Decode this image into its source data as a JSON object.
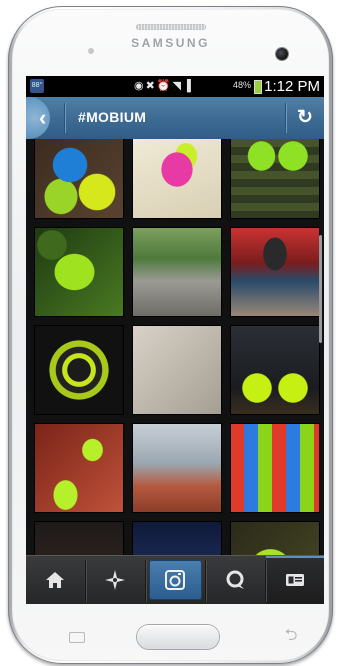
{
  "device": {
    "brand": "SAMSUNG"
  },
  "status_bar": {
    "battery_percent": "48%",
    "time": "1:12 PM",
    "icons": [
      "signal-icon",
      "mute-icon",
      "alarm-icon",
      "wifi-icon",
      "battery-icon"
    ]
  },
  "app_bar": {
    "title": "#MOBIUM",
    "back_icon": "chevron-left-icon",
    "refresh_icon": "refresh-icon"
  },
  "feed": {
    "photos": [
      {
        "desc": "blue and yellow running shoes pile"
      },
      {
        "desc": "pink and yellow running shoe"
      },
      {
        "desc": "green shoes on grass"
      },
      {
        "desc": "green shoe among leaves"
      },
      {
        "desc": "road through trees"
      },
      {
        "desc": "people in red car collage"
      },
      {
        "desc": "shoe sole close-up"
      },
      {
        "desc": "packed gear flat lay"
      },
      {
        "desc": "green shoes at dark gym"
      },
      {
        "desc": "legs wearing green shoes"
      },
      {
        "desc": "runner on track"
      },
      {
        "desc": "rows of colorful shoes"
      },
      {
        "desc": "night city lights"
      },
      {
        "desc": "dark blue evening sky"
      },
      {
        "desc": "green shoes in hands"
      }
    ]
  },
  "tab_bar": {
    "tabs": [
      {
        "name": "home",
        "icon": "home-icon",
        "active": false
      },
      {
        "name": "explore",
        "icon": "explore-star-icon",
        "active": false
      },
      {
        "name": "camera",
        "icon": "camera-icon",
        "active": true
      },
      {
        "name": "news",
        "icon": "speech-bubble-icon",
        "active": false
      },
      {
        "name": "profile",
        "icon": "profile-card-icon",
        "active": false
      }
    ]
  },
  "colors": {
    "app_bar": "#3c6a93",
    "active_tab": "#3a6fa0",
    "accent_green": "#8cd21e"
  }
}
